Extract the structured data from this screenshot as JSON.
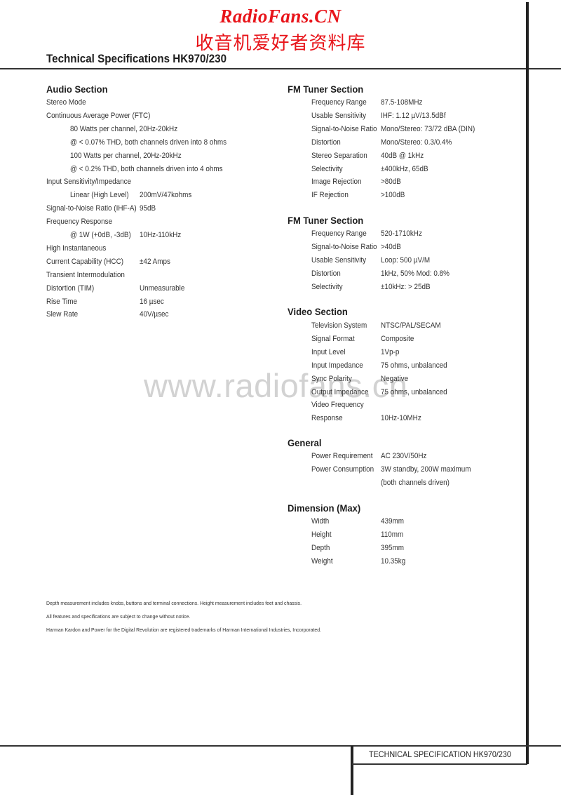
{
  "watermark": {
    "brand_en": "RadioFans.CN",
    "brand_cn": "收音机爱好者资料库",
    "site": "www.radiofans.cn",
    "color": "#e8141a"
  },
  "header": {
    "title": "Technical Specifications HK970/230"
  },
  "audio": {
    "title": "Audio Section",
    "rows": [
      {
        "label": "Stereo Mode",
        "value": ""
      },
      {
        "label": "Continuous Average Power (FTC)",
        "value": ""
      },
      {
        "label": "80 Watts per channel, 20Hz-20kHz",
        "value": ""
      },
      {
        "label": "@ < 0.07% THD, both channels driven into 8 ohms",
        "value": ""
      },
      {
        "label": "100 Watts per channel, 20Hz-20kHz",
        "value": ""
      },
      {
        "label": "@ < 0.2% THD, both channels driven into 4 ohms",
        "value": ""
      },
      {
        "label": "Input Sensitivity/Impedance",
        "value": ""
      },
      {
        "label": "Linear (High Level)",
        "value": "200mV/47kohms"
      },
      {
        "label": "Signal-to-Noise Ratio (IHF-A)",
        "value": "95dB"
      },
      {
        "label": "Frequency Response",
        "value": ""
      },
      {
        "label": "@ 1W (+0dB, -3dB)",
        "value": "10Hz-110kHz"
      },
      {
        "label": "High Instantaneous",
        "value": ""
      },
      {
        "label": "Current Capability (HCC)",
        "value": "±42 Amps"
      },
      {
        "label": "Transient Intermodulation",
        "value": ""
      },
      {
        "label": "Distortion (TIM)",
        "value": "Unmeasurable"
      },
      {
        "label": "Rise Time",
        "value": "16 µsec"
      },
      {
        "label": "Slew Rate",
        "value": "40V/µsec"
      }
    ]
  },
  "fm_tuner": {
    "title": "FM Tuner Section",
    "rows": [
      {
        "label": "Frequency Range",
        "value": "87.5-108MHz"
      },
      {
        "label": "Usable Sensitivity",
        "value": "IHF: 1.12 µV/13.5dBf"
      },
      {
        "label": "Signal-to-Noise Ratio",
        "value": "Mono/Stereo: 73/72 dBA (DIN)"
      },
      {
        "label": "Distortion",
        "value": "Mono/Stereo: 0.3/0.4%"
      },
      {
        "label": "Stereo Separation",
        "value": "40dB @ 1kHz"
      },
      {
        "label": "Selectivity",
        "value": "±400kHz, 65dB"
      },
      {
        "label": "Image Rejection",
        "value": ">80dB"
      },
      {
        "label": "IF Rejection",
        "value": ">100dB"
      }
    ]
  },
  "fm_tuner_2": {
    "title": "FM Tuner Section",
    "rows": [
      {
        "label": "Frequency Range",
        "value": "520-1710kHz"
      },
      {
        "label": "Signal-to-Noise Ratio",
        "value": ">40dB"
      },
      {
        "label": "Usable Sensitivity",
        "value": "Loop: 500 µV/M"
      },
      {
        "label": "Distortion",
        "value": "1kHz, 50% Mod: 0.8%"
      },
      {
        "label": "Selectivity",
        "value": "±10kHz: > 25dB"
      }
    ]
  },
  "video": {
    "title": "Video Section",
    "rows": [
      {
        "label": "Television System",
        "value": "NTSC/PAL/SECAM"
      },
      {
        "label": "Signal Format",
        "value": "Composite"
      },
      {
        "label": "Input Level",
        "value": "1Vp-p"
      },
      {
        "label": "Input Impedance",
        "value": "75 ohms, unbalanced"
      },
      {
        "label": "Sync Polarity",
        "value": "Negative"
      },
      {
        "label": "Output Impedance",
        "value": "75 ohms, unbalanced"
      },
      {
        "label": "Video Frequency",
        "value": ""
      },
      {
        "label": "Response",
        "value": "10Hz-10MHz"
      }
    ]
  },
  "general": {
    "title": "General",
    "rows": [
      {
        "label": "Power Requirement",
        "value": "AC 230V/50Hz"
      },
      {
        "label": "Power Consumption",
        "value": "3W standby, 200W maximum"
      },
      {
        "label": "",
        "value": "(both channels driven)"
      }
    ]
  },
  "dimension": {
    "title": "Dimension (Max)",
    "rows": [
      {
        "label": "Width",
        "value": "439mm"
      },
      {
        "label": "Height",
        "value": "110mm"
      },
      {
        "label": "Depth",
        "value": "395mm"
      },
      {
        "label": "Weight",
        "value": "10.35kg"
      }
    ]
  },
  "footnotes": [
    "Depth measurement includes knobs, buttons and terminal connections.  Height measurement includes feet and chassis.",
    "All features and specifications are subject to change without notice.",
    "Harman Kardon and Power for the Digital Revolution are registered trademarks of Harman International Industries, Incorporated."
  ],
  "footer": {
    "label": "TECHNICAL SPECIFICATION HK970/230"
  }
}
